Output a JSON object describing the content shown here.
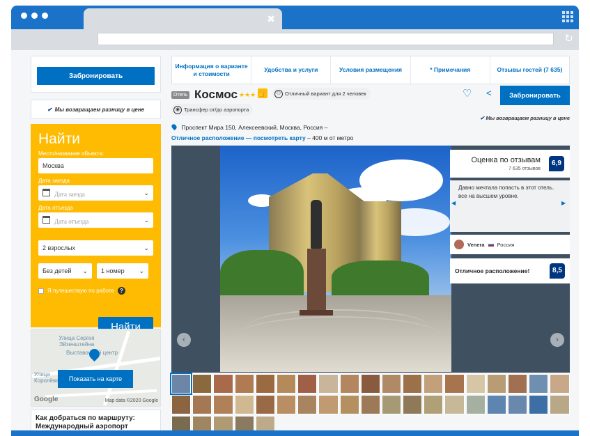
{
  "browser": {
    "tab_close": "✖",
    "reload": "↻"
  },
  "left": {
    "book_button": "Забронировать",
    "price_match": "Мы возвращаем разницу в цене",
    "search": {
      "title": "Найти",
      "destination_label": "Место/название объекта:",
      "destination_value": "Москва",
      "checkin_label": "Дата заезда",
      "checkin_placeholder": "Дата заезда",
      "checkout_label": "Дата отъезда",
      "checkout_placeholder": "Дата отъезда",
      "guests": "2 взрослых",
      "children": "Без детей",
      "rooms": "1 номер",
      "work_trip": "Я путешествую по работе",
      "submit": "Найти"
    },
    "map": {
      "street": "Улица Сергея Эйзенштейна",
      "center": "Выставочный центр",
      "street2": "Улица Королёва",
      "button": "Показать на карте",
      "logo": "Google",
      "copyright": "Map data ©2020 Google"
    },
    "route_title": "Как добраться по маршруту: Международный аэропорт"
  },
  "tabs": [
    "Информация о варианте и стоимости",
    "Удобства и услуги",
    "Условия размещения",
    "* Примечания",
    "Отзывы гостей (7 635)"
  ],
  "hotel": {
    "type_badge": "Отель",
    "name": "Космос",
    "stars": "★★★",
    "thumb_icon": "👍",
    "couple_note": "Отличный вариант для 2 человек",
    "transfer": "Трансфер от/до аэропорта",
    "book_button": "Забронировать",
    "price_match": "Мы возвращаем разницу в цене",
    "address": "Проспект Мира 150, Алексеевский, Москва, Россия –",
    "location_link": "Отличное расположение — посмотреть карту",
    "metro": " – 400 м от метро"
  },
  "review": {
    "title": "Оценка по отзывам",
    "count": "7 635 отзывов",
    "score": "6,9",
    "quote": "Давно мечтала попасть в этот отель. все на высшем уровне.",
    "author": "Venera",
    "country": "Россия",
    "location_label": "Отличное расположение!",
    "location_score": "8,5"
  },
  "gallery_colors": [
    "#6d86a8",
    "#8a6a3c",
    "#a86a4a",
    "#b07a52",
    "#9c6a40",
    "#b58a5a",
    "#a06048",
    "#c8b59a",
    "#b48660",
    "#8a5a3e",
    "#b08a66",
    "#9c7048",
    "#c2a07a",
    "#a8744e",
    "#d6c6a6",
    "#b89c76",
    "#a07050",
    "#6e8fb0",
    "#c8a888",
    "#8c6442",
    "#a47852",
    "#b08058",
    "#d0b890",
    "#9a6a46",
    "#b88e62",
    "#a88460",
    "#c09a70",
    "#b49060",
    "#9c7a58",
    "#a69a74",
    "#8e7a58",
    "#b0a078",
    "#c8b89a",
    "#a6b0a0",
    "#5e84b0",
    "#6888ac",
    "#3e6ea6",
    "#b8a888",
    "#7a6a4e",
    "#a08660",
    "#b09a74",
    "#8a7a60",
    "#bcaa8a"
  ]
}
